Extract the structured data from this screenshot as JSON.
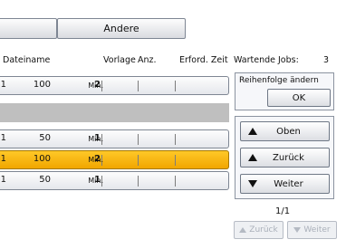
{
  "tabs": {
    "left_label": "",
    "other_label": "Andere"
  },
  "headers": {
    "filename": "Dateiname",
    "template": "Vorlage",
    "qty": "Anz.",
    "time": "Erford. Zeit",
    "waiting_label": "Wartende Jobs:",
    "waiting_count": "3"
  },
  "jobs": [
    {
      "copies": "1",
      "pages": "100",
      "time": "2",
      "unit": "Min.",
      "selected": false
    },
    {
      "copies": "1",
      "pages": "50",
      "time": "1",
      "unit": "Min.",
      "selected": false
    },
    {
      "copies": "1",
      "pages": "100",
      "time": "2",
      "unit": "Min.",
      "selected": true
    },
    {
      "copies": "1",
      "pages": "50",
      "time": "1",
      "unit": "Min.",
      "selected": false
    }
  ],
  "panel": {
    "reorder_label": "Reihenfolge ändern",
    "ok_label": "OK",
    "top_label": "Oben",
    "back_label": "Zurück",
    "forward_label": "Weiter"
  },
  "pagination": {
    "page_indicator": "1/1",
    "prev_label": "Zurück",
    "next_label": "Weiter"
  },
  "colors": {
    "selected_row": "#f5b000",
    "gray_bar": "#bfbfbf"
  }
}
